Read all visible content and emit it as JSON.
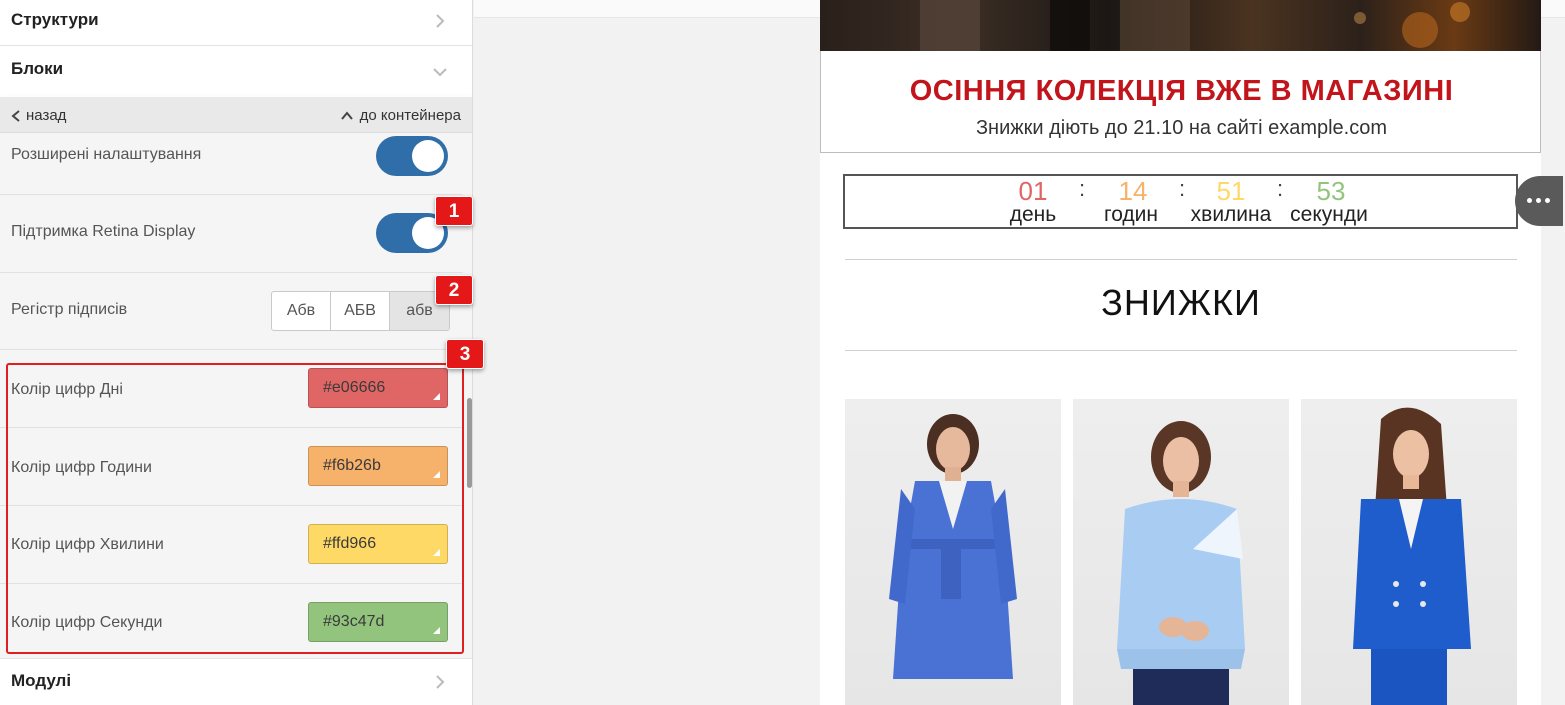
{
  "sidebar": {
    "structures_label": "Структури",
    "blocks_label": "Блоки",
    "modules_label": "Модулі",
    "back_label": "назад",
    "to_container_label": "до контейнера",
    "advanced_settings_label": "Розширені налаштування",
    "retina_label": "Підтримка Retina Display",
    "case_label": "Регістр підписів",
    "case_options": [
      "Абв",
      "АБВ",
      "абв"
    ],
    "colors": [
      {
        "label": "Колір цифр Дні",
        "value": "#e06666"
      },
      {
        "label": "Колір цифр Години",
        "value": "#f6b26b"
      },
      {
        "label": "Колір цифр Хвилини",
        "value": "#ffd966"
      },
      {
        "label": "Колір цифр Секунди",
        "value": "#93c47d"
      }
    ],
    "toggles": {
      "advanced": true,
      "retina": true
    },
    "selected_case": "абв"
  },
  "annotations": [
    "1",
    "2",
    "3"
  ],
  "preview": {
    "promo_title": "ОСІННЯ КОЛЕКЦІЯ ВЖЕ В МАГАЗИНІ",
    "promo_subtitle": "Знижки діють до 21.10 на сайті example.com",
    "timer": {
      "days": "01",
      "hours": "14",
      "minutes": "51",
      "seconds": "53",
      "days_label": "день",
      "hours_label": "годин",
      "minutes_label": "хвилина",
      "seconds_label": "секунди",
      "separator": ":"
    },
    "sale_title": "ЗНИЖКИ",
    "products": [
      {
        "name": "blue coat"
      },
      {
        "name": "light blue sweatshirt"
      },
      {
        "name": "blue blazer"
      }
    ]
  },
  "colors": {
    "accent_blue": "#2f6ea8",
    "promo_red": "#c1141b",
    "highlight_red": "#e02020"
  }
}
